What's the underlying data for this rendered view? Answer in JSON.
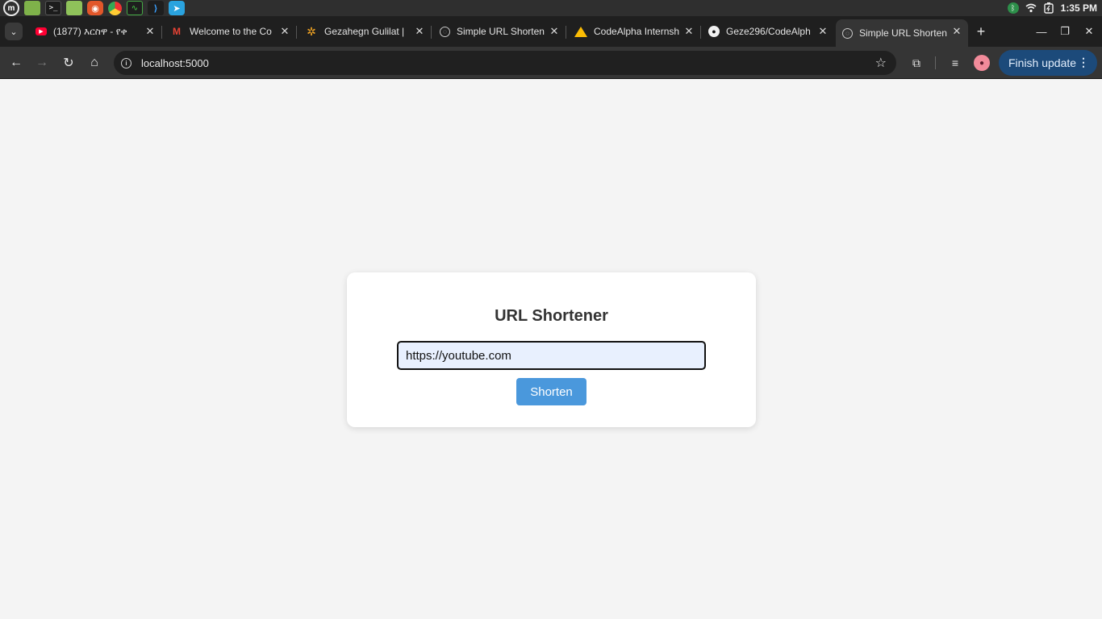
{
  "os_panel": {
    "apps": [
      {
        "name": "mint-menu-icon",
        "glyph": "m"
      },
      {
        "name": "show-desktop-icon",
        "glyph": ""
      },
      {
        "name": "terminal-icon",
        "glyph": ">_"
      },
      {
        "name": "files-icon",
        "glyph": ""
      },
      {
        "name": "ubuntu-software-icon",
        "glyph": "◉"
      },
      {
        "name": "chrome-icon",
        "glyph": ""
      },
      {
        "name": "system-monitor-icon",
        "glyph": "∿"
      },
      {
        "name": "vscode-icon",
        "glyph": "⟩"
      },
      {
        "name": "telegram-icon",
        "glyph": "➤"
      }
    ],
    "clock": "1:35 PM"
  },
  "tabs": [
    {
      "title": "(1877) እርስዋ - የቀ",
      "icon": "youtube-icon"
    },
    {
      "title": "Welcome to the Co",
      "icon": "gmail-icon"
    },
    {
      "title": "Gezahegn Gulilat | ",
      "icon": "star-logo-icon"
    },
    {
      "title": "Simple URL Shorten",
      "icon": "globe-icon"
    },
    {
      "title": "CodeAlpha Internsh",
      "icon": "google-drive-icon"
    },
    {
      "title": "Geze296/CodeAlph",
      "icon": "github-icon"
    },
    {
      "title": "Simple URL Shorten",
      "icon": "globe-icon"
    }
  ],
  "toolbar": {
    "url": "localhost:5000",
    "finish_update_label": "Finish update"
  },
  "main": {
    "title": "URL Shortener",
    "url_input_value": "https://youtube.com",
    "shorten_button_label": "Shorten"
  },
  "colors": {
    "page_background": "#f4f4f4",
    "button_blue": "#4a98dc",
    "input_background": "#e8f0fe",
    "update_button": "#1c4a7a"
  }
}
